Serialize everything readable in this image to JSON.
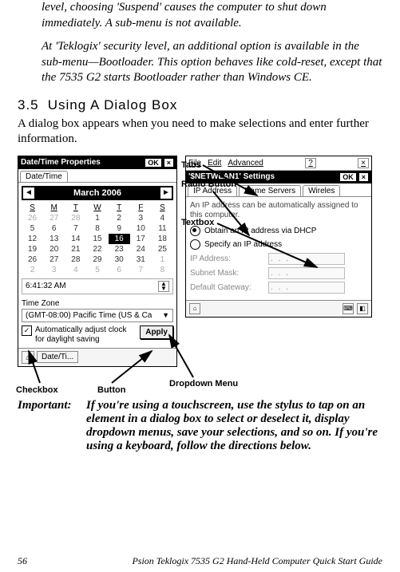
{
  "intro": {
    "p1": "level, choosing 'Suspend' causes the computer to shut down immediately. A sub-menu is not available.",
    "p2": "At 'Teklogix' security level, an additional option is available in the sub-menu—Bootloader. This option behaves like cold-reset, except that the 7535 G2 starts Bootloader rather than Windows CE."
  },
  "section": {
    "number": "3.5",
    "title": "Using A Dialog Box"
  },
  "body": "A dialog box appears when you need to make selections and enter further information.",
  "leftDialog": {
    "title": "Date/Time Properties",
    "ok": "OK",
    "tab1": "Date/Time",
    "monthArrowLeft": "◄",
    "monthArrowRight": "►",
    "month": "March 2006",
    "weekdays": [
      "S",
      "M",
      "T",
      "W",
      "T",
      "F",
      "S"
    ],
    "weeks": [
      [
        "26",
        "27",
        "28",
        "1",
        "2",
        "3",
        "4"
      ],
      [
        "5",
        "6",
        "7",
        "8",
        "9",
        "10",
        "11"
      ],
      [
        "12",
        "13",
        "14",
        "15",
        "16",
        "17",
        "18"
      ],
      [
        "19",
        "20",
        "21",
        "22",
        "23",
        "24",
        "25"
      ],
      [
        "26",
        "27",
        "28",
        "29",
        "30",
        "31",
        "1"
      ],
      [
        "2",
        "3",
        "4",
        "5",
        "6",
        "7",
        "8"
      ]
    ],
    "selectedDay": "16",
    "time": "6:41:32 AM",
    "tzLabel": "Time Zone",
    "tzValue": "(GMT-08:00) Pacific Time (US & Ca",
    "chkText": "Automatically adjust clock for daylight saving",
    "applyLabel": "Apply",
    "taskBtn": "Date/Ti..."
  },
  "rightDialog": {
    "menuFile": "File",
    "menuEdit": "Edit",
    "menuAdv": "Advanced",
    "menuQ": "?",
    "title": "'$NETWLAN1' Settings",
    "ok": "OK",
    "tab1": "IP Address",
    "tab2": "Name Servers",
    "tab3": "Wireles",
    "msg": "An IP address can be automatically assigned to this computer.",
    "radio1": "Obtain an IP address via DHCP",
    "radio2": "Specify an IP address",
    "f1": "IP Address:",
    "f2": "Subnet Mask:",
    "f3": "Default Gateway:",
    "dots": ".   .   ."
  },
  "callouts": {
    "tabs": "Tabs",
    "radio": "Radio Button",
    "textbox": "Textbox",
    "checkbox": "Checkbox",
    "button": "Button",
    "dropdown": "Dropdown Menu"
  },
  "important": {
    "label": "Important:",
    "text": "If you're using a touchscreen, use the stylus to tap on an element in a dialog box to select or deselect it, display dropdown menus, save your selections, and so on. If you're using a keyboard, follow the directions below."
  },
  "footer": {
    "page": "56",
    "title": "Psion Teklogix 7535 G2 Hand-Held Computer Quick Start Guide"
  }
}
